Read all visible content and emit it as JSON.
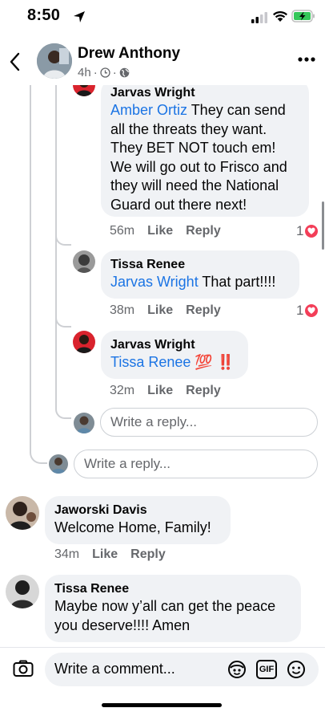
{
  "status_bar": {
    "time": "8:50"
  },
  "header": {
    "author": "Drew Anthony",
    "time_ago": "4h"
  },
  "comments": [
    {
      "name": "Jarvas Wright",
      "mention": "Amber Ortiz",
      "text_lines": [
        " They can send",
        "all the threats they want.",
        "They BET NOT touch em!",
        "We will go out to Frisco and",
        "they will need the National",
        "Guard out there next!"
      ],
      "time": "56m",
      "like": "Like",
      "reply": "Reply",
      "reactions": "1"
    },
    {
      "name": "Tissa Renee",
      "mention": "Jarvas Wright",
      "text": " That part!!!!",
      "time": "38m",
      "like": "Like",
      "reply": "Reply",
      "reactions": "1"
    },
    {
      "name": "Jarvas Wright",
      "mention": "Tissa Renee",
      "text": "💯 ‼️",
      "time": "32m",
      "like": "Like",
      "reply": "Reply"
    },
    {
      "name": "Jaworski Davis",
      "text": "Welcome Home, Family!",
      "time": "34m",
      "like": "Like",
      "reply": "Reply"
    },
    {
      "name": "Tissa Renee",
      "text_lines": [
        "Maybe now y’all can get the peace",
        "you deserve!!!! Amen"
      ]
    }
  ],
  "reply_placeholder": "Write a reply...",
  "composer": {
    "placeholder": "Write a comment...",
    "gif_label": "GIF"
  },
  "colors": {
    "mention": "#1b74e4",
    "bubble": "#f0f2f5",
    "heart": "#f33e58",
    "secondary_text": "#65676b"
  }
}
